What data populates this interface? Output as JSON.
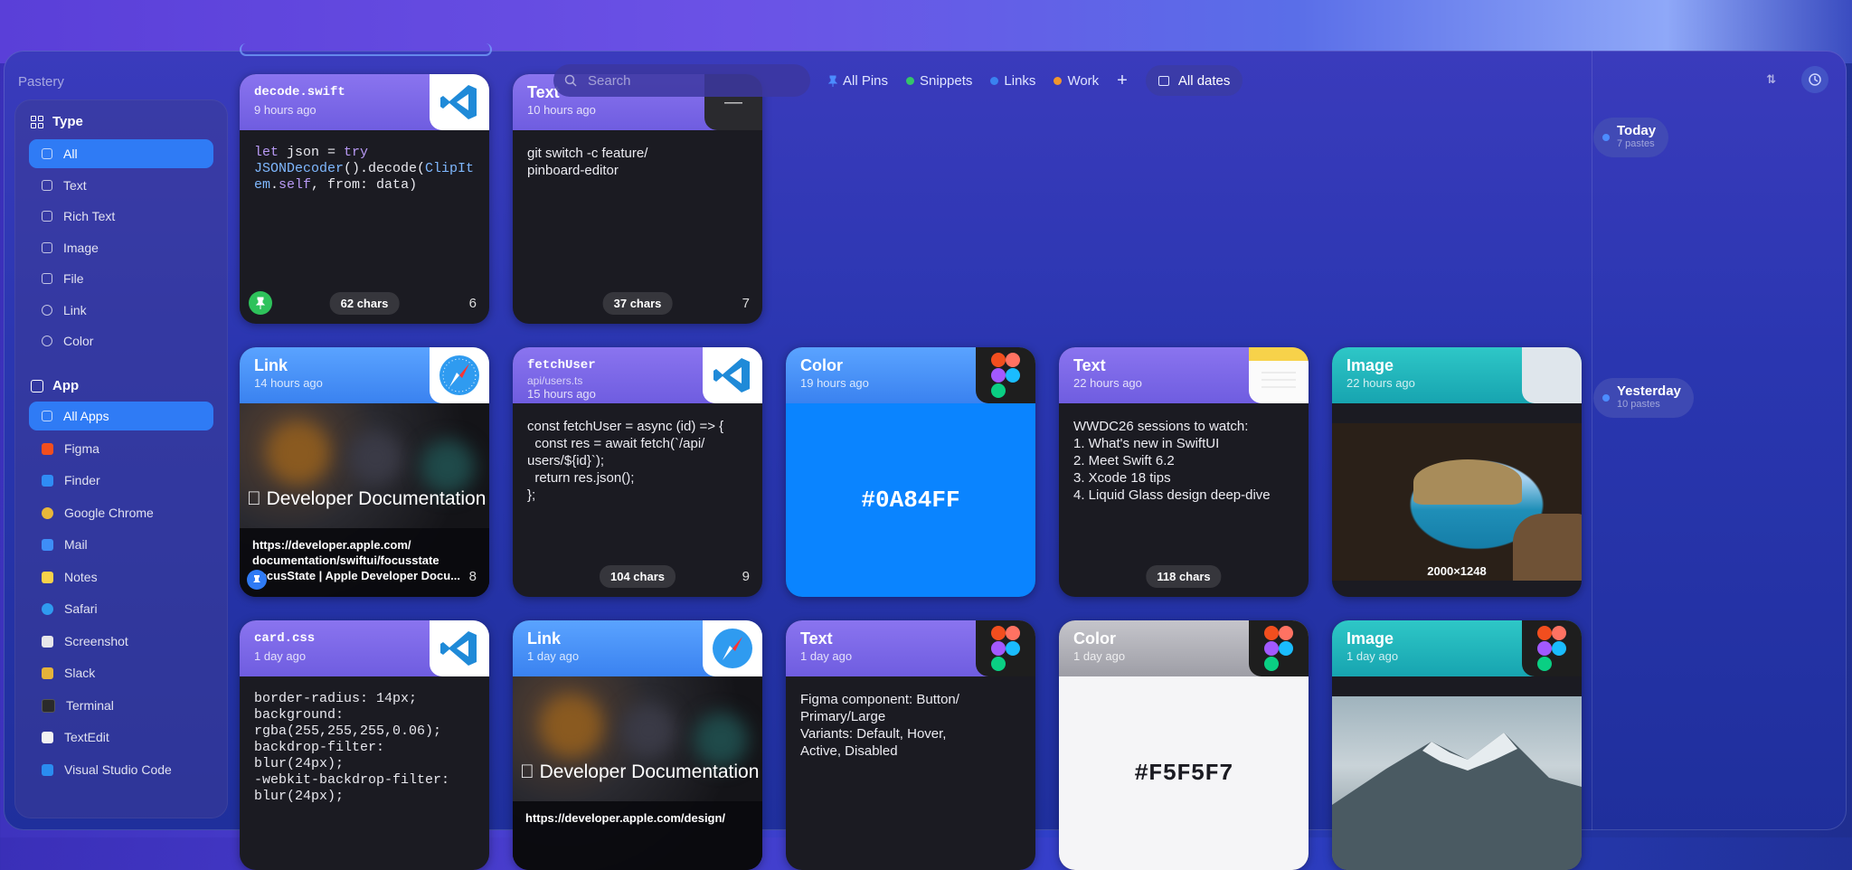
{
  "app": {
    "title": "Pastery"
  },
  "sidebar": {
    "type_section": {
      "label": "Type",
      "items": [
        {
          "label": "All",
          "active": true
        },
        {
          "label": "Text"
        },
        {
          "label": "Rich Text"
        },
        {
          "label": "Image"
        },
        {
          "label": "File"
        },
        {
          "label": "Link"
        },
        {
          "label": "Color"
        }
      ]
    },
    "app_section": {
      "label": "App",
      "items": [
        {
          "label": "All Apps",
          "active": true
        },
        {
          "label": "Figma",
          "color": "#f24e1e"
        },
        {
          "label": "Finder",
          "color": "#2f8cf5"
        },
        {
          "label": "Google Chrome",
          "color": "#e8b73a"
        },
        {
          "label": "Mail",
          "color": "#3e8ef7"
        },
        {
          "label": "Notes",
          "color": "#f7d24a"
        },
        {
          "label": "Safari",
          "color": "#2f9bf0"
        },
        {
          "label": "Screenshot",
          "color": "#e6e6ea"
        },
        {
          "label": "Slack",
          "color": "#e5b33a"
        },
        {
          "label": "Terminal",
          "color": "#2a2a2a"
        },
        {
          "label": "TextEdit",
          "color": "#f2f2f2"
        },
        {
          "label": "Visual Studio Code",
          "color": "#2a8cf0"
        }
      ]
    }
  },
  "toolbar": {
    "search_placeholder": "Search",
    "filters": [
      {
        "label": "All Pins",
        "color": "#4c8cff"
      },
      {
        "label": "Snippets",
        "color": "#35c46a"
      },
      {
        "label": "Links",
        "color": "#3a82f0"
      },
      {
        "label": "Work",
        "color": "#f0962e"
      }
    ],
    "add_label": "+",
    "dates_label": "All dates"
  },
  "timeline": [
    {
      "label": "Today",
      "count": "7 pastes"
    },
    {
      "label": "Yesterday",
      "count": "10 pastes"
    }
  ],
  "cards": {
    "c1": {
      "title": "decode.swift",
      "time": "9 hours ago",
      "code": [
        "let json = try",
        "JSONDecoder().decode(ClipIt",
        "em.self, from: data)"
      ],
      "chars": "62 chars",
      "num": "6"
    },
    "c2": {
      "title": "Text",
      "time": "10 hours ago",
      "text": "git switch -c feature/\npinboard-editor",
      "chars": "37 chars",
      "num": "7"
    },
    "c3": {
      "title": "Link",
      "time": "14 hours ago",
      "doc": "Developer Documentation",
      "url": "https://developer.apple.com/\ndocumentation/swiftui/focusstate",
      "caption": "FocusState | Apple Developer Docu...",
      "num": "8"
    },
    "c4": {
      "title": "fetchUser",
      "path": "api/users.ts",
      "time": "15 hours ago",
      "text": "const fetchUser = async (id) => {\n  const res = await fetch(`/api/\nusers/${id}`);\n  return res.json();\n};",
      "chars": "104 chars",
      "num": "9"
    },
    "c5": {
      "title": "Color",
      "time": "19 hours ago",
      "hex": "#0A84FF"
    },
    "c6": {
      "title": "Text",
      "time": "22 hours ago",
      "text": "WWDC26 sessions to watch:\n1. What's new in SwiftUI\n2. Meet Swift 6.2\n3. Xcode 18 tips\n4. Liquid Glass design deep-dive",
      "chars": "118 chars"
    },
    "c7": {
      "title": "Image",
      "time": "22 hours ago",
      "dims": "2000×1248"
    },
    "c8": {
      "title": "card.css",
      "time": "1 day ago",
      "code": "border-radius: 14px;\nbackground:\nrgba(255,255,255,0.06);\nbackdrop-filter:\nblur(24px);\n-webkit-backdrop-filter:\nblur(24px);"
    },
    "c9": {
      "title": "Link",
      "time": "1 day ago",
      "doc": "Developer Documentation",
      "url": "https://developer.apple.com/design/"
    },
    "c10": {
      "title": "Text",
      "time": "1 day ago",
      "text": "Figma component: Button/\nPrimary/Large\nVariants: Default, Hover,\nActive, Disabled"
    },
    "c11": {
      "title": "Color",
      "time": "1 day ago",
      "hex": "#F5F5F7"
    },
    "c12": {
      "title": "Image",
      "time": "1 day ago"
    }
  }
}
